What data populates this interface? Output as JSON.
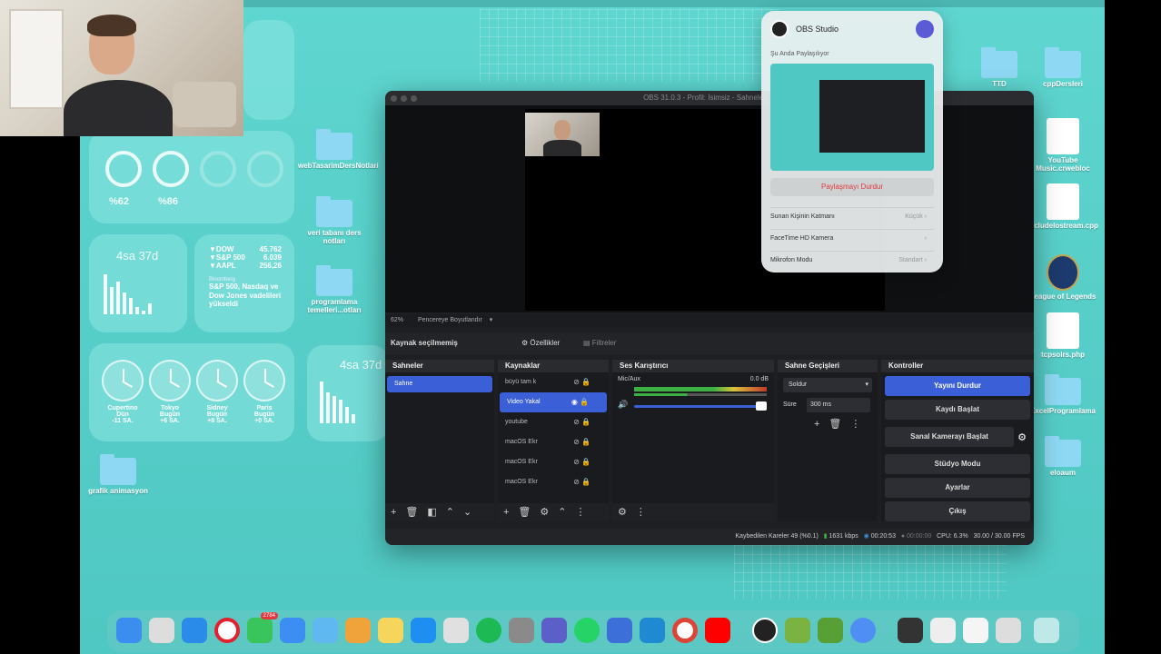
{
  "widgets": {
    "battery": {
      "items": [
        "%62",
        "%86"
      ]
    },
    "screen_time_1": {
      "value": "4sa 37d"
    },
    "screen_time_2": {
      "value": "4sa 37d"
    },
    "stocks": {
      "rows": [
        {
          "symbol": "▼DOW",
          "value": "45.762"
        },
        {
          "symbol": "▼S&P 500",
          "value": "6.039"
        },
        {
          "symbol": "▼AAPL",
          "value": "256,26"
        }
      ],
      "source": "Bloomberg",
      "headline": "S&P 500, Nasdaq ve Dow Jones vadelileri yükseldi"
    },
    "clocks": [
      {
        "city": "Cupertino",
        "day": "Dün",
        "offset": "-11 SA."
      },
      {
        "city": "Tokyo",
        "day": "Bugün",
        "offset": "+6 SA."
      },
      {
        "city": "Sidney",
        "day": "Bugün",
        "offset": "+8 SA."
      },
      {
        "city": "Paris",
        "day": "Bugün",
        "offset": "+0 SA."
      }
    ]
  },
  "desktop_left": [
    {
      "label": "webTasarimDersNotlari"
    },
    {
      "label": "veri tabanı ders notları"
    },
    {
      "label": "programlama temelleri...otları"
    },
    {
      "label": "grafik animasyon"
    }
  ],
  "desktop_right": [
    {
      "label": "TTD"
    },
    {
      "label": "cppDersleri"
    },
    {
      "label": "YouTube Music.crwebloc"
    },
    {
      "label": "includeIostream.cpp"
    },
    {
      "label": "League of Legends"
    },
    {
      "label": "tcpsolrs.php"
    },
    {
      "label": "ExcelProgramlama"
    },
    {
      "label": "eloaum"
    }
  ],
  "obs": {
    "title": "OBS 31.0.3 - Profil: İsimsiz - Sahneler: ...",
    "zoom": "62%",
    "preview_label": "Pencereye Boyutlandır",
    "no_source": "Kaynak seçilmemiş",
    "properties": "Özellikler",
    "filters": "Filtreler",
    "panels": {
      "scenes": {
        "title": "Sahneler",
        "items": [
          "Sahne"
        ]
      },
      "sources": {
        "title": "Kaynaklar",
        "items": [
          "büyü tam k",
          "Video Yakal",
          "youtube",
          "macOS Ekr",
          "macOS Ekr",
          "macOS Ekr"
        ]
      },
      "mixer": {
        "title": "Ses Karıştırıcı",
        "channel": "Mic/Aux",
        "level": "0.0 dB"
      },
      "transitions": {
        "title": "Sahne Geçişleri",
        "type": "Soldur",
        "duration_label": "Süre",
        "duration": "300 ms"
      },
      "controls": {
        "title": "Kontroller",
        "buttons": [
          "Yayını Durdur",
          "Kaydı Başlat",
          "Sanal Kamerayı Başlat",
          "Stüdyo Modu",
          "Ayarlar",
          "Çıkış"
        ]
      }
    },
    "status": {
      "dropped": "Kaybedilen Kareler 49 (%0.1)",
      "bitrate": "1631 kbps",
      "live": "00:20:53",
      "rec": "00:00:00",
      "cpu": "CPU: 6.3%",
      "fps": "30.00 / 30.00 FPS"
    }
  },
  "share": {
    "app": "OBS Studio",
    "now_sharing": "Şu Anda Paylaşılıyor",
    "stop": "Paylaşmayı Durdur",
    "rows": [
      {
        "label": "Sunan Kişinin Katmanı",
        "value": "Küçük"
      },
      {
        "label": "FaceTime HD Kamera",
        "value": ""
      },
      {
        "label": "Mikrofon Modu",
        "value": "Standart"
      }
    ]
  },
  "dock": {
    "badge": "2784"
  },
  "colors": {
    "accent": "#3a5fd6",
    "desktop": "#5fd6d0",
    "stop": "#e0383e"
  }
}
